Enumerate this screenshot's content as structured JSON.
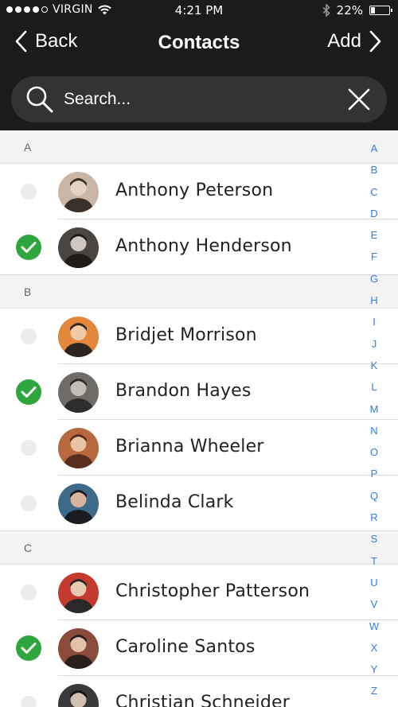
{
  "status": {
    "carrier": "VIRGIN",
    "time": "4:21 PM",
    "battery": "22%",
    "battery_level": 0.22,
    "signal_bars": 4
  },
  "nav": {
    "back_label": "Back",
    "title": "Contacts",
    "add_label": "Add"
  },
  "search": {
    "placeholder": "Search...",
    "value": ""
  },
  "colors": {
    "header_bg": "#1b1b1b",
    "search_bg": "#333333",
    "check_on": "#2fa53e",
    "index_link": "#2e7fe0"
  },
  "sections": [
    {
      "letter": "A",
      "contacts": [
        {
          "name": "Anthony Peterson",
          "selected": false,
          "avatar": "avatar-photo"
        },
        {
          "name": "Anthony Henderson",
          "selected": true,
          "avatar": "avatar-photo"
        }
      ]
    },
    {
      "letter": "B",
      "contacts": [
        {
          "name": "Bridjet Morrison",
          "selected": false,
          "avatar": "avatar-photo"
        },
        {
          "name": "Brandon Hayes",
          "selected": true,
          "avatar": "avatar-photo"
        },
        {
          "name": "Brianna Wheeler",
          "selected": false,
          "avatar": "avatar-photo"
        },
        {
          "name": "Belinda Clark",
          "selected": false,
          "avatar": "avatar-photo"
        }
      ]
    },
    {
      "letter": "C",
      "contacts": [
        {
          "name": "Christopher Patterson",
          "selected": false,
          "avatar": "avatar-photo"
        },
        {
          "name": "Caroline Santos",
          "selected": true,
          "avatar": "avatar-photo"
        },
        {
          "name": "Christian Schneider",
          "selected": false,
          "avatar": "avatar-photo"
        }
      ]
    }
  ],
  "index_letters": [
    "A",
    "B",
    "C",
    "D",
    "E",
    "F",
    "G",
    "H",
    "I",
    "J",
    "K",
    "L",
    "M",
    "N",
    "O",
    "P",
    "Q",
    "R",
    "S",
    "T",
    "U",
    "V",
    "W",
    "X",
    "Y",
    "Z"
  ]
}
